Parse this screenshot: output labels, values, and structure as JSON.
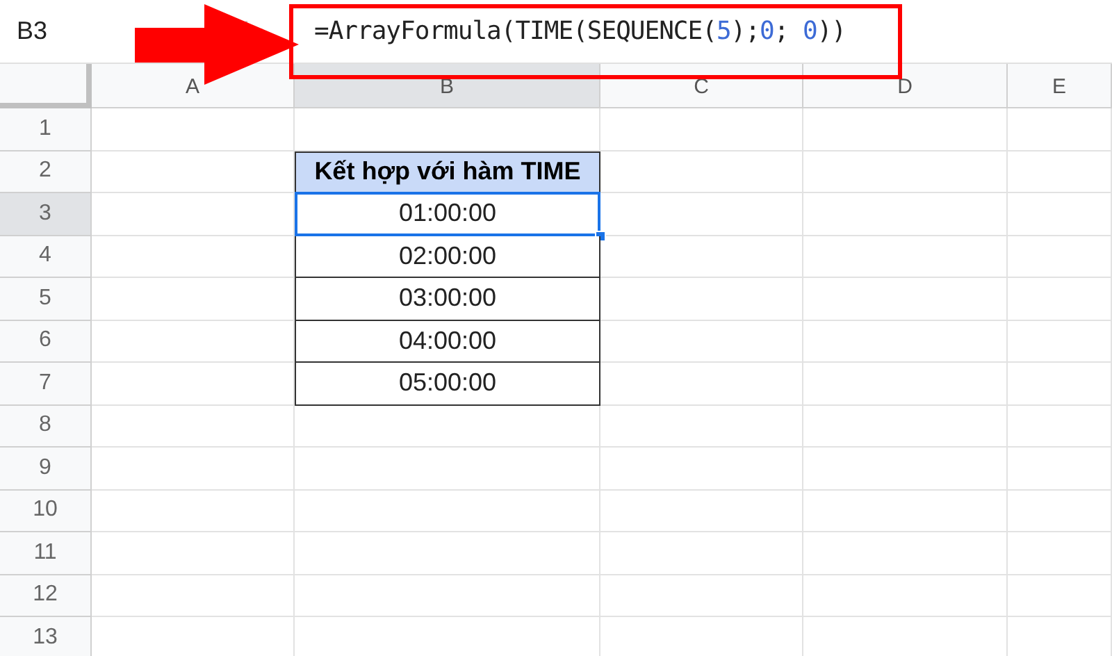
{
  "name_box": "B3",
  "formula": [
    {
      "text": "=ArrayFormula(TIME(SEQUENCE(",
      "kind": "plain"
    },
    {
      "text": "5",
      "kind": "number"
    },
    {
      "text": ");",
      "kind": "plain"
    },
    {
      "text": "0",
      "kind": "number"
    },
    {
      "text": "; ",
      "kind": "plain"
    },
    {
      "text": "0",
      "kind": "number"
    },
    {
      "text": "))",
      "kind": "plain"
    }
  ],
  "columns": [
    {
      "label": "A",
      "selected": false
    },
    {
      "label": "B",
      "selected": true
    },
    {
      "label": "C",
      "selected": false
    },
    {
      "label": "D",
      "selected": false
    },
    {
      "label": "E",
      "selected": false
    }
  ],
  "rows": [
    {
      "label": "1",
      "selected": false
    },
    {
      "label": "2",
      "selected": false,
      "cell_b": {
        "text": "Kết hợp với hàm TIME",
        "kind": "header",
        "selected": false
      }
    },
    {
      "label": "3",
      "selected": true,
      "cell_b": {
        "text": "01:00:00",
        "kind": "value",
        "selected": true
      }
    },
    {
      "label": "4",
      "selected": false,
      "cell_b": {
        "text": "02:00:00",
        "kind": "value",
        "selected": false
      }
    },
    {
      "label": "5",
      "selected": false,
      "cell_b": {
        "text": "03:00:00",
        "kind": "value",
        "selected": false
      }
    },
    {
      "label": "6",
      "selected": false,
      "cell_b": {
        "text": "04:00:00",
        "kind": "value",
        "selected": false
      }
    },
    {
      "label": "7",
      "selected": false,
      "cell_b": {
        "text": "05:00:00",
        "kind": "value",
        "selected": false
      }
    },
    {
      "label": "8",
      "selected": false
    },
    {
      "label": "9",
      "selected": false
    },
    {
      "label": "10",
      "selected": false
    },
    {
      "label": "11",
      "selected": false
    },
    {
      "label": "12",
      "selected": false
    },
    {
      "label": "13",
      "selected": false
    }
  ],
  "annotations": {
    "arrow": true,
    "highlight_box": true
  }
}
